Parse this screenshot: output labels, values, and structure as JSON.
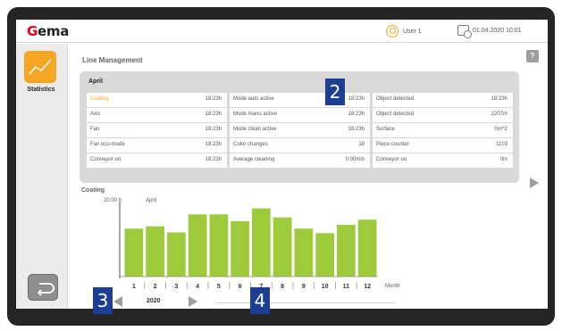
{
  "app": {
    "brand": "Gema"
  },
  "header": {
    "user": "User 1",
    "datetime": "01.04.2020 10:01"
  },
  "sidebar": {
    "statistics_label": "Statistics"
  },
  "main": {
    "title": "Line Management",
    "help": "?",
    "month": "April",
    "table": [
      [
        {
          "label": "Coating",
          "value": "18:23h"
        },
        {
          "label": "Mode auto active",
          "value": "18:23h"
        },
        {
          "label": "Object detected",
          "value": "18:23h"
        }
      ],
      [
        {
          "label": "Axis",
          "value": "18:23h"
        },
        {
          "label": "Mode manu active",
          "value": "18:23h"
        },
        {
          "label": "Object detected",
          "value": "2207m"
        }
      ],
      [
        {
          "label": "Fan",
          "value": "18:23h"
        },
        {
          "label": "Mode clean active",
          "value": "18:23h"
        },
        {
          "label": "Surface",
          "value": "0m^2"
        }
      ],
      [
        {
          "label": "Fan eco-mode",
          "value": "18:23h"
        },
        {
          "label": "Color changes",
          "value": "18"
        },
        {
          "label": "Piece counter",
          "value": "1103"
        }
      ],
      [
        {
          "label": "Conveyor on",
          "value": "18:23h"
        },
        {
          "label": "Average cleaning",
          "value": "0:00min"
        },
        {
          "label": "Conveyor on",
          "value": "0m"
        }
      ]
    ]
  },
  "chart": {
    "title": "Coating",
    "ymax_label": "20:00 h",
    "period": "April",
    "x_unit": "Month",
    "year": "2020"
  },
  "chart_data": {
    "type": "bar",
    "title": "Coating",
    "xlabel": "Month",
    "ylabel": "",
    "categories": [
      "1",
      "2",
      "3",
      "4",
      "5",
      "6",
      "7",
      "8",
      "9",
      "10",
      "11",
      "12"
    ],
    "values": [
      12.8,
      13.4,
      11.8,
      16.6,
      16.6,
      14.8,
      18.2,
      15.8,
      12.8,
      11.6,
      13.8,
      15.2
    ],
    "ylim": [
      0,
      20
    ],
    "bar_color": "#9ecb3b",
    "grid": false
  },
  "callouts": [
    "2",
    "3",
    "4"
  ],
  "colors": {
    "accent": "#f5a623",
    "bar": "#9ecb3b",
    "callout": "#1c3f94"
  }
}
